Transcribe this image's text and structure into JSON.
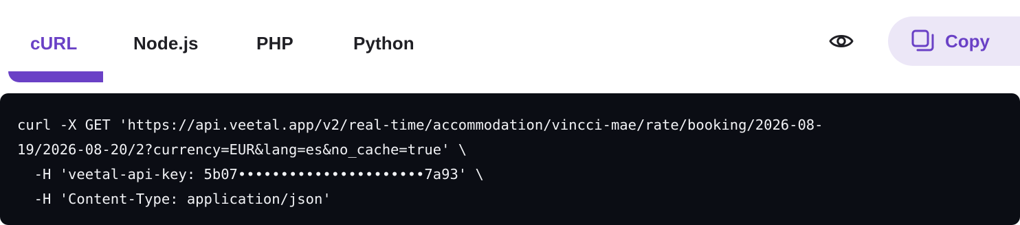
{
  "tabs": [
    {
      "label": "cURL",
      "active": true
    },
    {
      "label": "Node.js",
      "active": false
    },
    {
      "label": "PHP",
      "active": false
    },
    {
      "label": "Python",
      "active": false
    }
  ],
  "toolbar": {
    "reveal_icon": "eye-icon",
    "copy_icon": "copy-icon",
    "copy_label": "Copy"
  },
  "colors": {
    "accent": "#6a41c6",
    "accent_soft": "#ece7f7",
    "code_bg": "#0b0d14",
    "code_text": "#f1f2f5"
  },
  "code": {
    "lines": [
      "curl -X GET 'https://api.veetal.app/v2/real-time/accommodation/vincci-mae/rate/booking/2026-08-",
      "19/2026-08-20/2?currency=EUR&lang=es&no_cache=true' \\",
      "  -H 'veetal-api-key: 5b07••••••••••••••••••••••7a93' \\",
      "  -H 'Content-Type: application/json'"
    ]
  }
}
